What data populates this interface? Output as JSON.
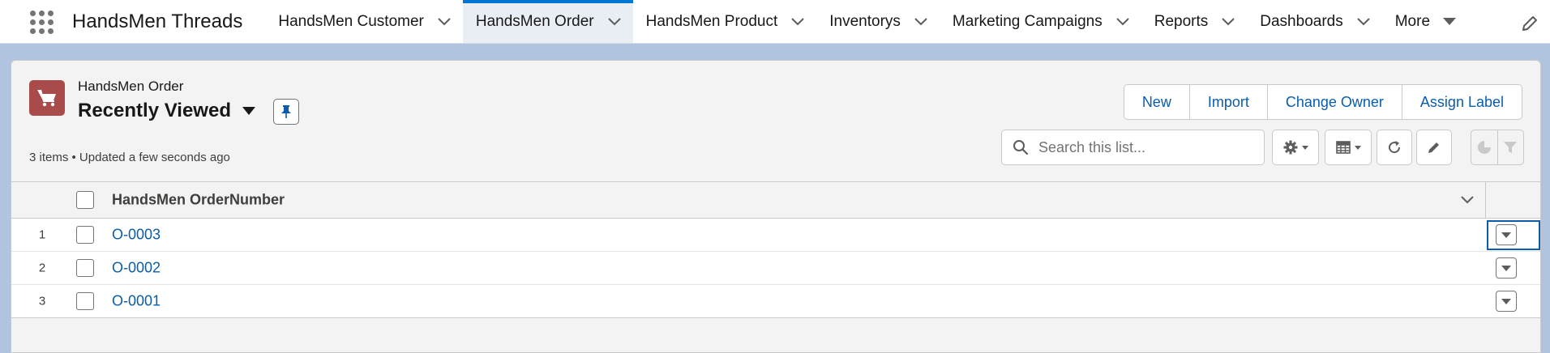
{
  "app": {
    "name": "HandsMen Threads",
    "launcher_icon": "app-launcher-waffle-icon"
  },
  "nav": {
    "tabs": [
      {
        "label": "HandsMen Customer",
        "active": false
      },
      {
        "label": "HandsMen Order",
        "active": true
      },
      {
        "label": "HandsMen Product",
        "active": false
      },
      {
        "label": "Inventorys",
        "active": false
      },
      {
        "label": "Marketing Campaigns",
        "active": false
      },
      {
        "label": "Reports",
        "active": false
      },
      {
        "label": "Dashboards",
        "active": false
      }
    ],
    "more_label": "More",
    "edit_icon": "pencil-icon"
  },
  "list_header": {
    "object_label": "HandsMen Order",
    "view_name": "Recently Viewed",
    "object_icon": "cart-icon",
    "meta": "3 items • Updated a few seconds ago"
  },
  "actions": {
    "new_label": "New",
    "import_label": "Import",
    "change_owner_label": "Change Owner",
    "assign_label": "Assign Label"
  },
  "search": {
    "placeholder": "Search this list...",
    "value": ""
  },
  "table": {
    "columns": [
      {
        "label": "HandsMen OrderNumber"
      }
    ],
    "rows": [
      {
        "num": "1",
        "order_number": "O-0003"
      },
      {
        "num": "2",
        "order_number": "O-0002"
      },
      {
        "num": "3",
        "order_number": "O-0001"
      }
    ]
  },
  "colors": {
    "brand_blue": "#0176d3",
    "link_blue": "#0b5cab",
    "object_icon_bg": "#a94b4b",
    "page_bg": "#b0c4df"
  }
}
